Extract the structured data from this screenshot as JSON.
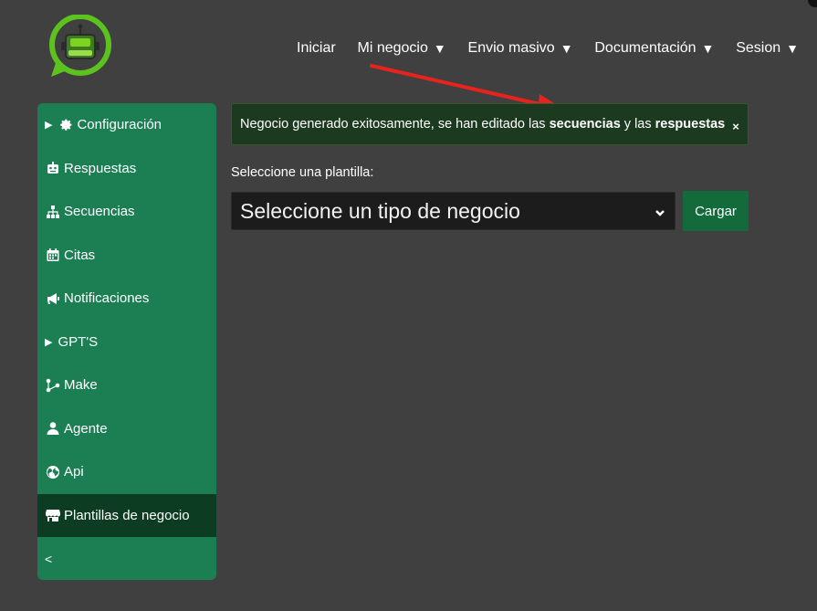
{
  "colors": {
    "background": "#404040",
    "sidebar": "#1c7f53",
    "sidebar_active": "#0c3d23",
    "alert_bg": "#1c3a1f",
    "button": "#136b3c",
    "annotation_arrow": "#e8231e"
  },
  "nav": {
    "items": [
      {
        "label": "Iniciar",
        "caret": ""
      },
      {
        "label": "Mi negocio",
        "caret": "▼"
      },
      {
        "label": "Envio masivo",
        "caret": "▼"
      },
      {
        "label": "Documentación",
        "caret": "▼"
      },
      {
        "label": "Sesion",
        "caret": "▼"
      }
    ]
  },
  "sidebar": {
    "items": [
      {
        "label": "Configuración",
        "icon": "gear-icon",
        "expandable": "▶"
      },
      {
        "label": "Respuestas",
        "icon": "robot-icon"
      },
      {
        "label": "Secuencias",
        "icon": "sitemap-icon"
      },
      {
        "label": "Citas",
        "icon": "calendar-icon"
      },
      {
        "label": "Notificaciones",
        "icon": "megaphone-icon"
      },
      {
        "label": "GPT'S",
        "icon": "",
        "expandable": "▶"
      },
      {
        "label": "Make",
        "icon": "share-nodes-icon"
      },
      {
        "label": "Agente",
        "icon": "user-icon"
      },
      {
        "label": "Api",
        "icon": "globe-icon"
      },
      {
        "label": "Plantillas de negocio",
        "icon": "store-icon",
        "active": true
      }
    ],
    "collapse_label": "<"
  },
  "alert": {
    "text_before": "Negocio generado exitosamente, se han editado las ",
    "bold1": "secuencias",
    "text_middle": " y las ",
    "bold2": "respuestas",
    "close": "×"
  },
  "form": {
    "label": "Seleccione una plantilla:",
    "select_value": "Seleccione un tipo de negocio",
    "button_label": "Cargar"
  }
}
